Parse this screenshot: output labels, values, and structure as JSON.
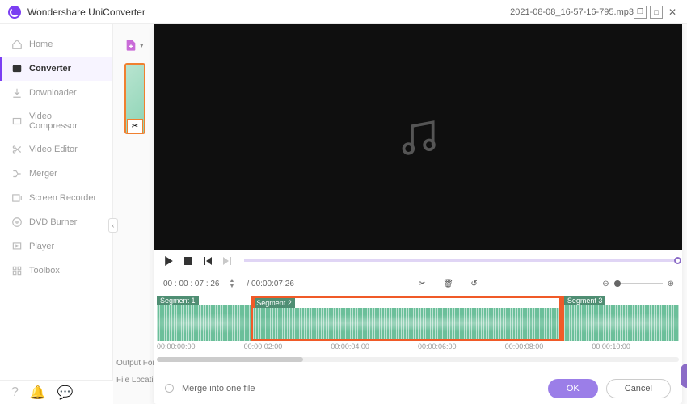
{
  "app": {
    "title": "Wondershare UniConverter",
    "filename": "2021-08-08_16-57-16-795.mp3"
  },
  "sidebar": {
    "items": [
      {
        "label": "Home"
      },
      {
        "label": "Converter"
      },
      {
        "label": "Downloader"
      },
      {
        "label": "Video Compressor"
      },
      {
        "label": "Video Editor"
      },
      {
        "label": "Merger"
      },
      {
        "label": "Screen Recorder"
      },
      {
        "label": "DVD Burner"
      },
      {
        "label": "Player"
      },
      {
        "label": "Toolbox"
      }
    ]
  },
  "bottomLabels": {
    "output": "Output Form",
    "location": "File Location"
  },
  "time": {
    "field": "00 : 00 : 07 : 26",
    "total": "/  00:00:07:26"
  },
  "segments": [
    {
      "label": "Segment 1"
    },
    {
      "label": "Segment 2"
    },
    {
      "label": "Segment 3"
    }
  ],
  "ruler": [
    "00:00:00:00",
    "00:00:02:00",
    "00:00:04:00",
    "00:00:06:00",
    "00:00:08:00",
    "00:00:10:00"
  ],
  "footer": {
    "merge": "Merge into one file",
    "ok": "OK",
    "cancel": "Cancel"
  }
}
